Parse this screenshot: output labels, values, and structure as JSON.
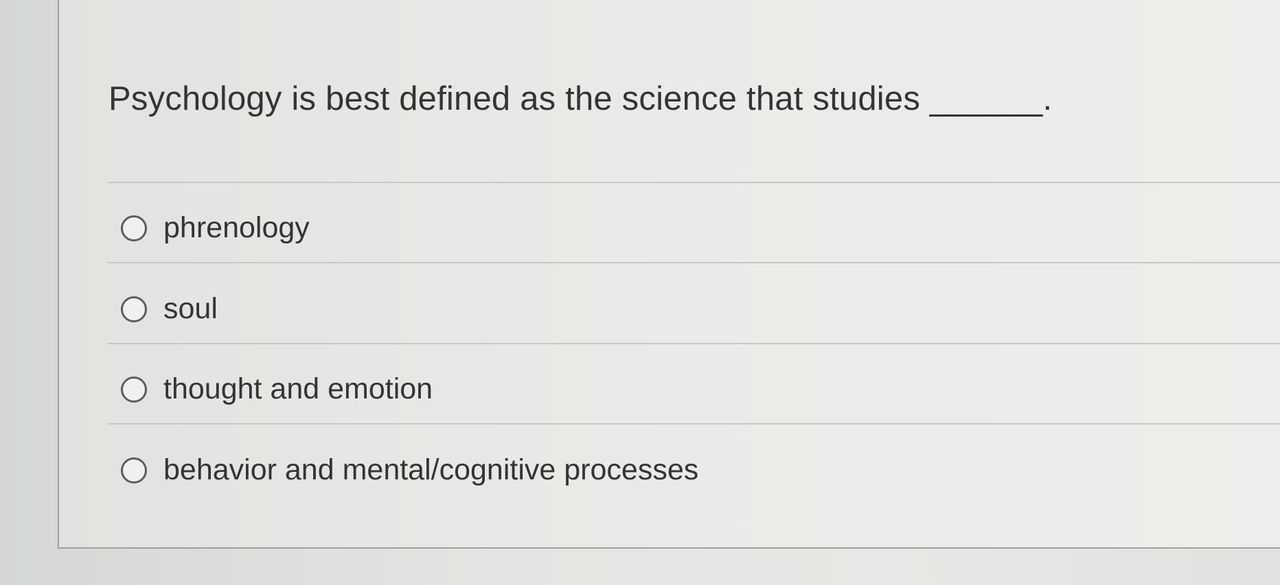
{
  "question": {
    "text": "Psychology is best defined as the science that studies ______."
  },
  "choices": [
    {
      "label": "phrenology",
      "selected": false
    },
    {
      "label": "soul",
      "selected": false
    },
    {
      "label": "thought and emotion",
      "selected": false
    },
    {
      "label": "behavior and mental/cognitive processes",
      "selected": false
    }
  ]
}
